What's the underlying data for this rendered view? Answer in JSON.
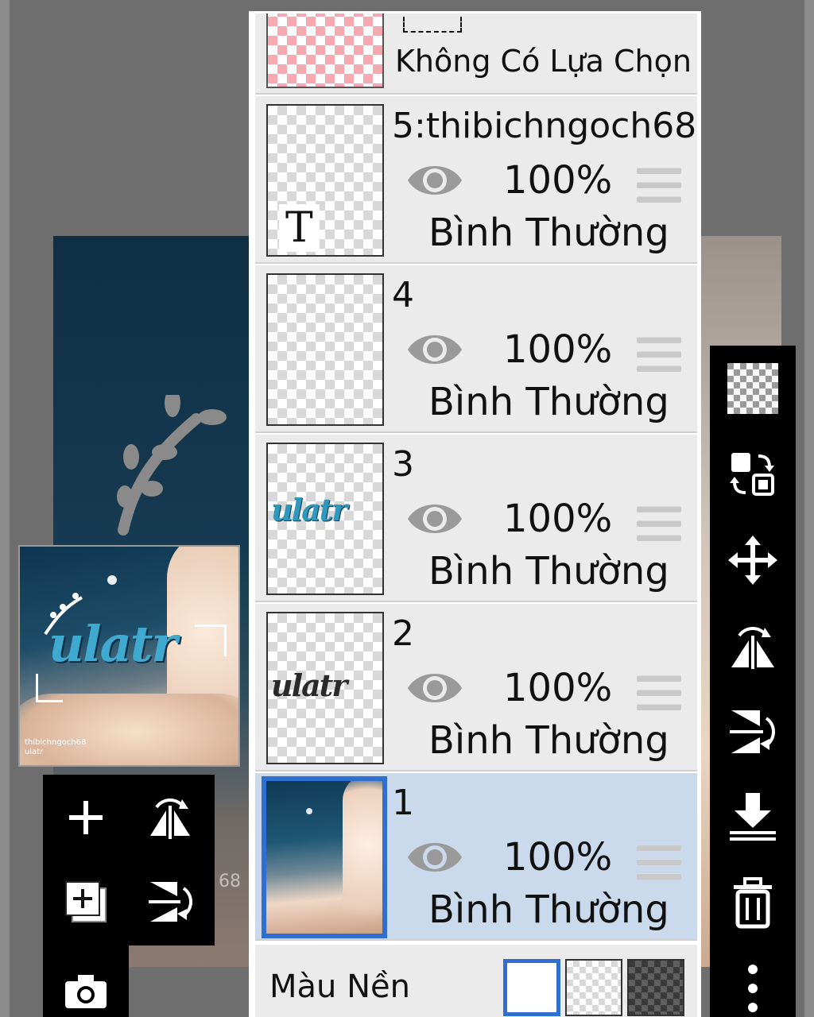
{
  "canvas": {
    "watermark": "68"
  },
  "preview": {
    "artwork_text": "ulatr",
    "credit_line1": "thibichngoch68",
    "credit_line2": "ulatr"
  },
  "selection": {
    "label": "Không Có Lựa Chọn"
  },
  "layers": [
    {
      "name": "5:thibichngoch68",
      "opacity": "100%",
      "blend": "Bình Thường",
      "thumb_text": "T",
      "selected": false
    },
    {
      "name": "4",
      "opacity": "100%",
      "blend": "Bình Thường",
      "thumb_text": "",
      "selected": false
    },
    {
      "name": "3",
      "opacity": "100%",
      "blend": "Bình Thường",
      "thumb_text": "ulatr",
      "selected": false
    },
    {
      "name": "2",
      "opacity": "100%",
      "blend": "Bình Thường",
      "thumb_text": "ulatr",
      "selected": false
    },
    {
      "name": "1",
      "opacity": "100%",
      "blend": "Bình Thường",
      "thumb_text": "",
      "selected": true
    }
  ],
  "background_color": {
    "label": "Màu Nền",
    "options": [
      "white",
      "transparent",
      "dark-checker"
    ],
    "selected": "white"
  },
  "left_toolbar": {
    "icons": [
      "plus-icon",
      "flip-horizontal-icon",
      "add-copy-icon",
      "flip-vertical-icon",
      "camera-icon"
    ]
  },
  "right_toolbar": {
    "icons": [
      "transparency-checker-icon",
      "swap-layers-icon",
      "move-icon",
      "flip-horizontal-icon",
      "flip-vertical-icon",
      "merge-down-icon",
      "trash-icon",
      "more-vertical-icon"
    ]
  },
  "colors": {
    "selected_layer_bg": "#cbd9ec",
    "selection_accent": "#2f6fd1",
    "toolbar_bg": "#000000",
    "panel_row_bg": "#ebebeb"
  }
}
